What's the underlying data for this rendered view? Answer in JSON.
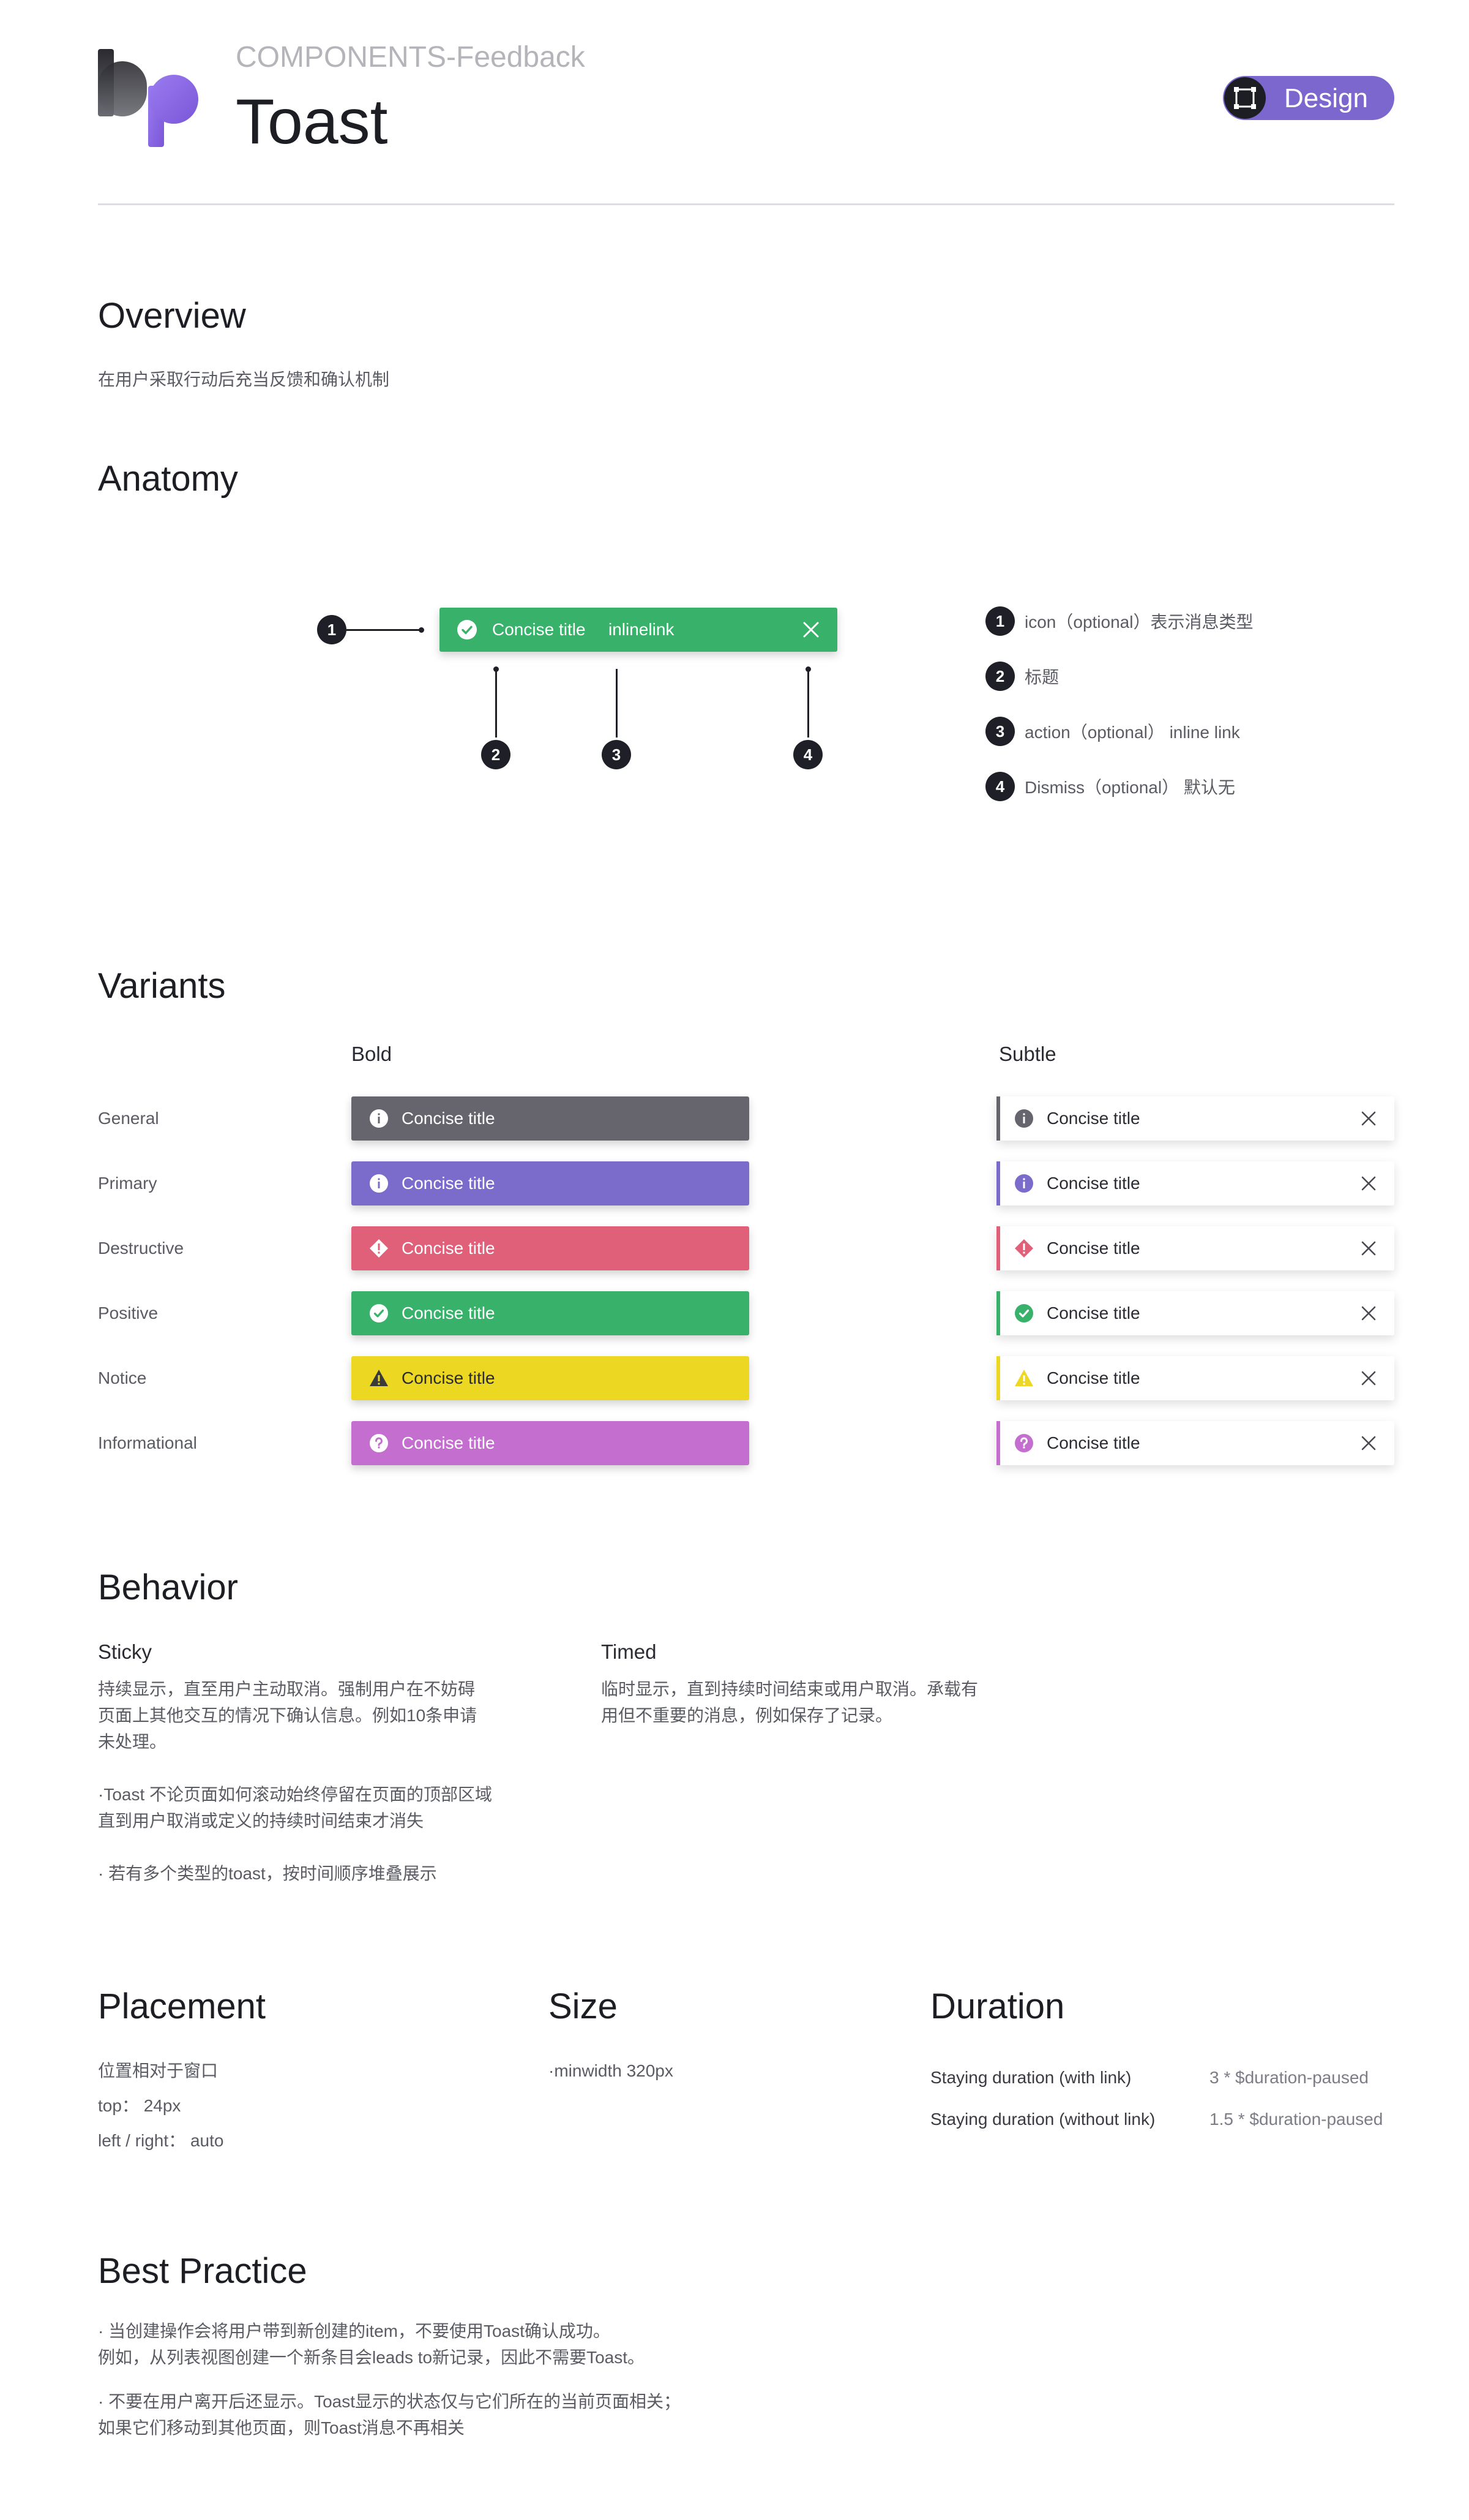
{
  "header": {
    "subtitle": "COMPONENTS-Feedback",
    "title": "Toast",
    "badge_label": "Design",
    "badge_icon": "frame-icon",
    "logo_icon": "bp-logo"
  },
  "colors": {
    "accent": "#7c67cf",
    "general": "#66656e",
    "primary": "#7b6bcb",
    "destructive": "#e0607a",
    "positive": "#38b26a",
    "notice": "#ecd722",
    "informational": "#c46fcf"
  },
  "overview": {
    "heading": "Overview",
    "text": "在用户采取行动后充当反馈和确认机制"
  },
  "anatomy": {
    "heading": "Anatomy",
    "toast_title": "Concise title",
    "toast_link": "inlinelink",
    "markers": [
      "1",
      "2",
      "3",
      "4"
    ],
    "legend": [
      {
        "num": "1",
        "text": "icon（optional）表示消息类型"
      },
      {
        "num": "2",
        "text": "标题"
      },
      {
        "num": "3",
        "text": "action（optional）    inline link"
      },
      {
        "num": "4",
        "text": "Dismiss（optional）    默认无"
      }
    ]
  },
  "variants": {
    "heading": "Variants",
    "col_bold": "Bold",
    "col_subtle": "Subtle",
    "rows": [
      {
        "label": "General",
        "title": "Concise title",
        "icon": "info-icon",
        "color": "#66656e"
      },
      {
        "label": "Primary",
        "title": "Concise title",
        "icon": "info-icon",
        "color": "#7b6bcb"
      },
      {
        "label": "Destructive",
        "title": "Concise title",
        "icon": "error-diamond-icon",
        "color": "#e0607a"
      },
      {
        "label": "Positive",
        "title": "Concise title",
        "icon": "check-circle-icon",
        "color": "#38b26a"
      },
      {
        "label": "Notice",
        "title": "Concise title",
        "icon": "warning-triangle-icon",
        "color": "#ecd722"
      },
      {
        "label": "Informational",
        "title": "Concise title",
        "icon": "help-circle-icon",
        "color": "#c46fcf"
      }
    ]
  },
  "behavior": {
    "heading": "Behavior",
    "sticky": {
      "title": "Sticky",
      "lines": [
        "持续显示，直至用户主动取消。强制用户在不妨碍",
        "页面上其他交互的情况下确认信息。例如10条申请",
        "未处理。",
        "",
        "·Toast 不论页面如何滚动始终停留在页面的顶部区域",
        "直到用户取消或定义的持续时间结束才消失",
        "",
        "· 若有多个类型的toast，按时间顺序堆叠展示"
      ]
    },
    "timed": {
      "title": "Timed",
      "lines": [
        "临时显示，直到持续时间结束或用户取消。承载有",
        "用但不重要的消息，例如保存了记录。"
      ]
    }
  },
  "placement": {
    "heading": "Placement",
    "lines": [
      "位置相对于窗口",
      "top：  24px",
      "left / right：  auto"
    ]
  },
  "size": {
    "heading": "Size",
    "lines": [
      "·minwidth 320px"
    ]
  },
  "duration": {
    "heading": "Duration",
    "rows": [
      {
        "label": "Staying duration (with link)",
        "value": "3 * $duration-paused"
      },
      {
        "label": "Staying duration (without link)",
        "value": "1.5 * $duration-paused"
      }
    ]
  },
  "best_practice": {
    "heading": "Best Practice",
    "lines": [
      "· 当创建操作会将用户带到新创建的item，不要使用Toast确认成功。",
      "例如，从列表视图创建一个新条目会leads to新记录，因此不需要Toast。",
      "",
      "· 不要在用户离开后还显示。Toast显示的状态仅与它们所在的当前页面相关；",
      "如果它们移动到其他页面，则Toast消息不再相关"
    ]
  }
}
